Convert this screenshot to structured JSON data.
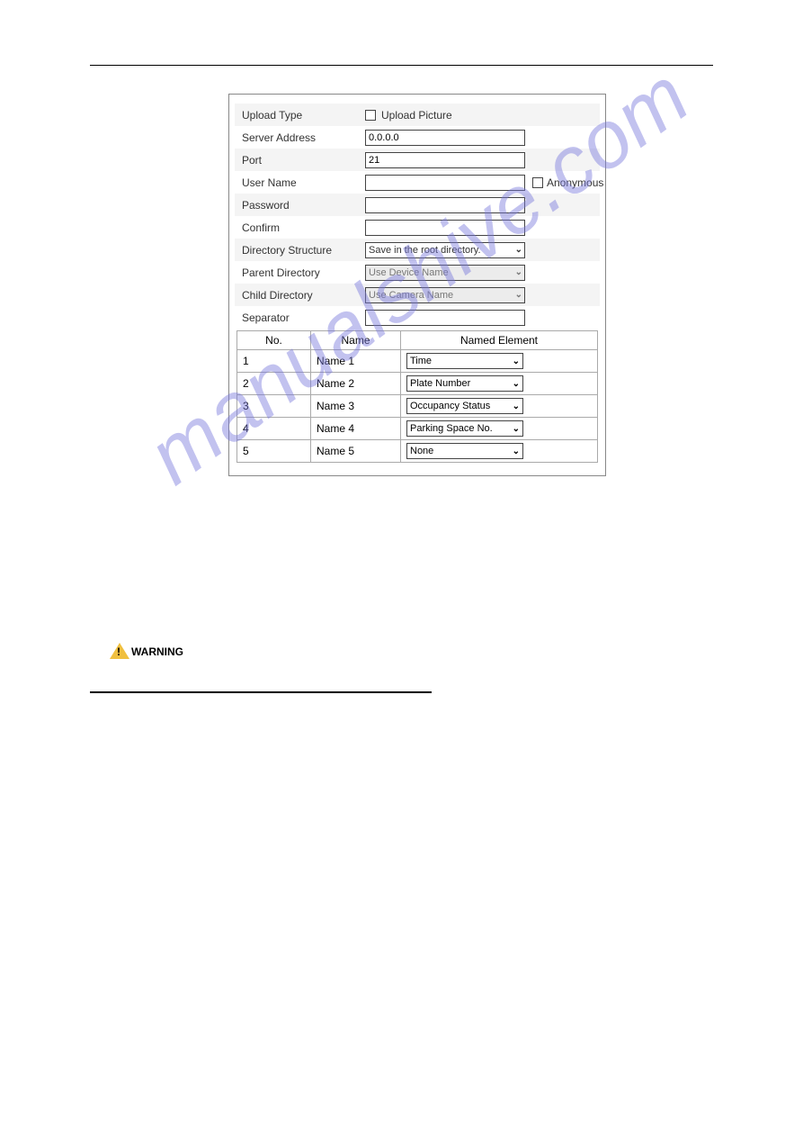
{
  "watermark": "manualshive.com",
  "warning_label": "WARNING",
  "form": {
    "upload_type_label": "Upload Type",
    "upload_picture_label": "Upload Picture",
    "server_address_label": "Server Address",
    "server_address_value": "0.0.0.0",
    "port_label": "Port",
    "port_value": "21",
    "user_name_label": "User Name",
    "user_name_value": "",
    "anonymous_label": "Anonymous",
    "password_label": "Password",
    "password_value": "",
    "confirm_label": "Confirm",
    "confirm_value": "",
    "directory_structure_label": "Directory Structure",
    "directory_structure_value": "Save in the root directory.",
    "parent_directory_label": "Parent Directory",
    "parent_directory_value": "Use Device Name",
    "child_directory_label": "Child Directory",
    "child_directory_value": "Use Camera Name",
    "separator_label": "Separator",
    "separator_value": ""
  },
  "table": {
    "headers": {
      "no": "No.",
      "name": "Name",
      "named_element": "Named Element"
    },
    "rows": [
      {
        "no": "1",
        "name": "Name 1",
        "element": "Time"
      },
      {
        "no": "2",
        "name": "Name 2",
        "element": "Plate Number"
      },
      {
        "no": "3",
        "name": "Name 3",
        "element": "Occupancy Status"
      },
      {
        "no": "4",
        "name": "Name 4",
        "element": "Parking Space No."
      },
      {
        "no": "5",
        "name": "Name 5",
        "element": "None"
      }
    ]
  }
}
